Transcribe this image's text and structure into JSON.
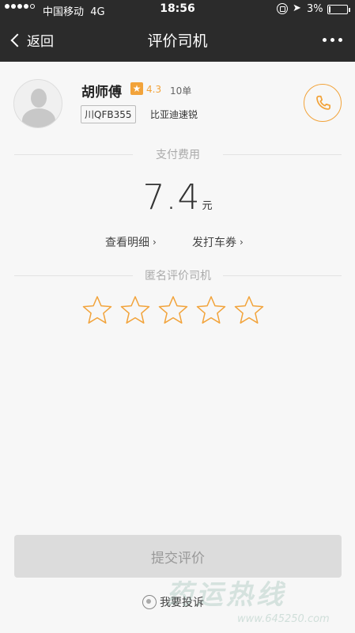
{
  "status_bar": {
    "carrier": "中国移动",
    "network": "4G",
    "time": "18:56",
    "battery_percent": "3%"
  },
  "navbar": {
    "back_label": "返回",
    "title": "评价司机"
  },
  "driver": {
    "name": "胡师傅",
    "rating": "4.3",
    "orders": "10单",
    "plate": "川QFB355",
    "car_model": "比亚迪速锐"
  },
  "payment": {
    "section_label": "支付费用",
    "amount": "7.4",
    "unit": "元",
    "detail_link": "查看明细",
    "coupon_link": "发打车券"
  },
  "rating_section": {
    "label": "匿名评价司机",
    "stars_selected": 0,
    "stars_total": 5
  },
  "actions": {
    "submit_label": "提交评价",
    "complaint_label": "我要投诉"
  },
  "watermark": {
    "text": "药运热线",
    "url": "www.645250.com"
  },
  "colors": {
    "accent": "#f2a33a",
    "nav_bg": "#2b2b2b",
    "page_bg": "#f7f7f7",
    "button_disabled": "#dcdcdc"
  }
}
